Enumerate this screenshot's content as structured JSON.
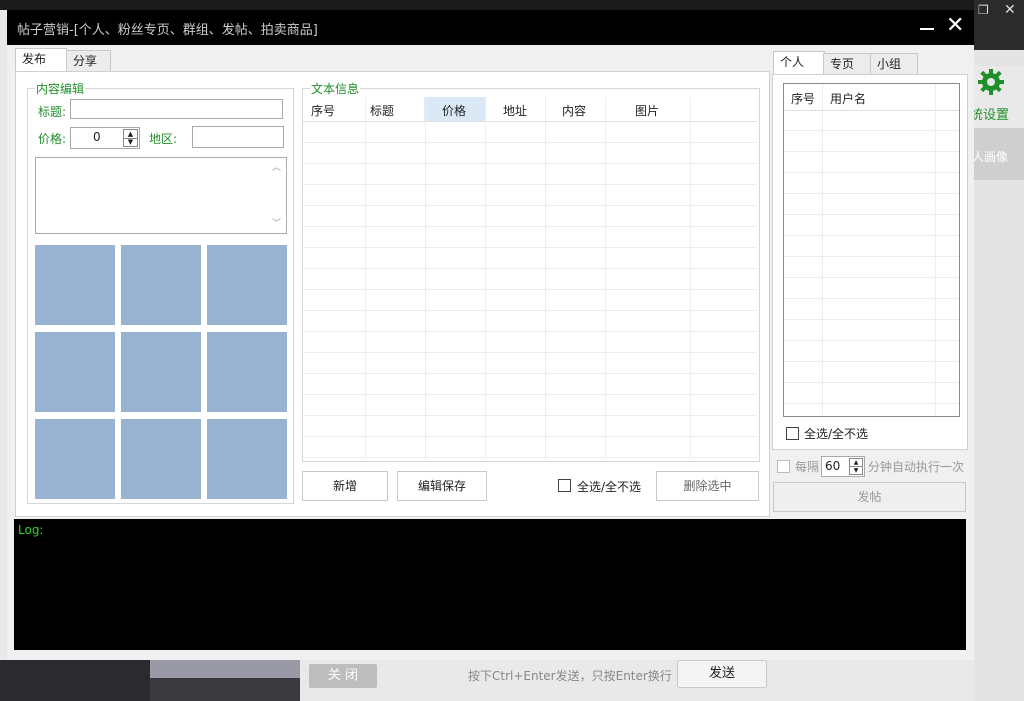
{
  "window": {
    "title": "帖子营销-[个人、粉丝专页、群组、发帖、拍卖商品]"
  },
  "tabs_left": [
    {
      "label": "发布",
      "active": true
    },
    {
      "label": "分享",
      "active": false
    }
  ],
  "content_edit": {
    "group_title": "内容编辑",
    "title_label": "标题:",
    "title_value": "",
    "price_label": "价格:",
    "price_value": "0",
    "region_label": "地区:",
    "region_value": "",
    "body_value": ""
  },
  "text_info": {
    "group_title": "文本信息",
    "columns": [
      "序号",
      "标题",
      "价格",
      "地址",
      "内容",
      "图片"
    ],
    "selected_column": "价格",
    "rows": []
  },
  "text_info_actions": {
    "add_label": "新增",
    "save_label": "编辑保存",
    "select_all_label": "全选/全不选",
    "delete_label": "删除选中"
  },
  "tabs_right": [
    {
      "label": "个人",
      "active": true
    },
    {
      "label": "专页",
      "active": false
    },
    {
      "label": "小组",
      "active": false
    }
  ],
  "user_table": {
    "columns": [
      "序号",
      "用户名"
    ],
    "rows": []
  },
  "right_actions": {
    "select_all_label": "全选/全不选",
    "interval_prefix": "每隔",
    "interval_value": "60",
    "interval_suffix": "分钟自动执行一次",
    "post_label": "发帖"
  },
  "log": {
    "label": "Log:"
  },
  "background_app": {
    "settings_label": "统设置",
    "portrait_label": "人画像",
    "close_label": "关 闭",
    "hint": "按下Ctrl+Enter发送，只按Enter换行",
    "send_label": "发送",
    "accent_green": "#1f8f2a"
  }
}
